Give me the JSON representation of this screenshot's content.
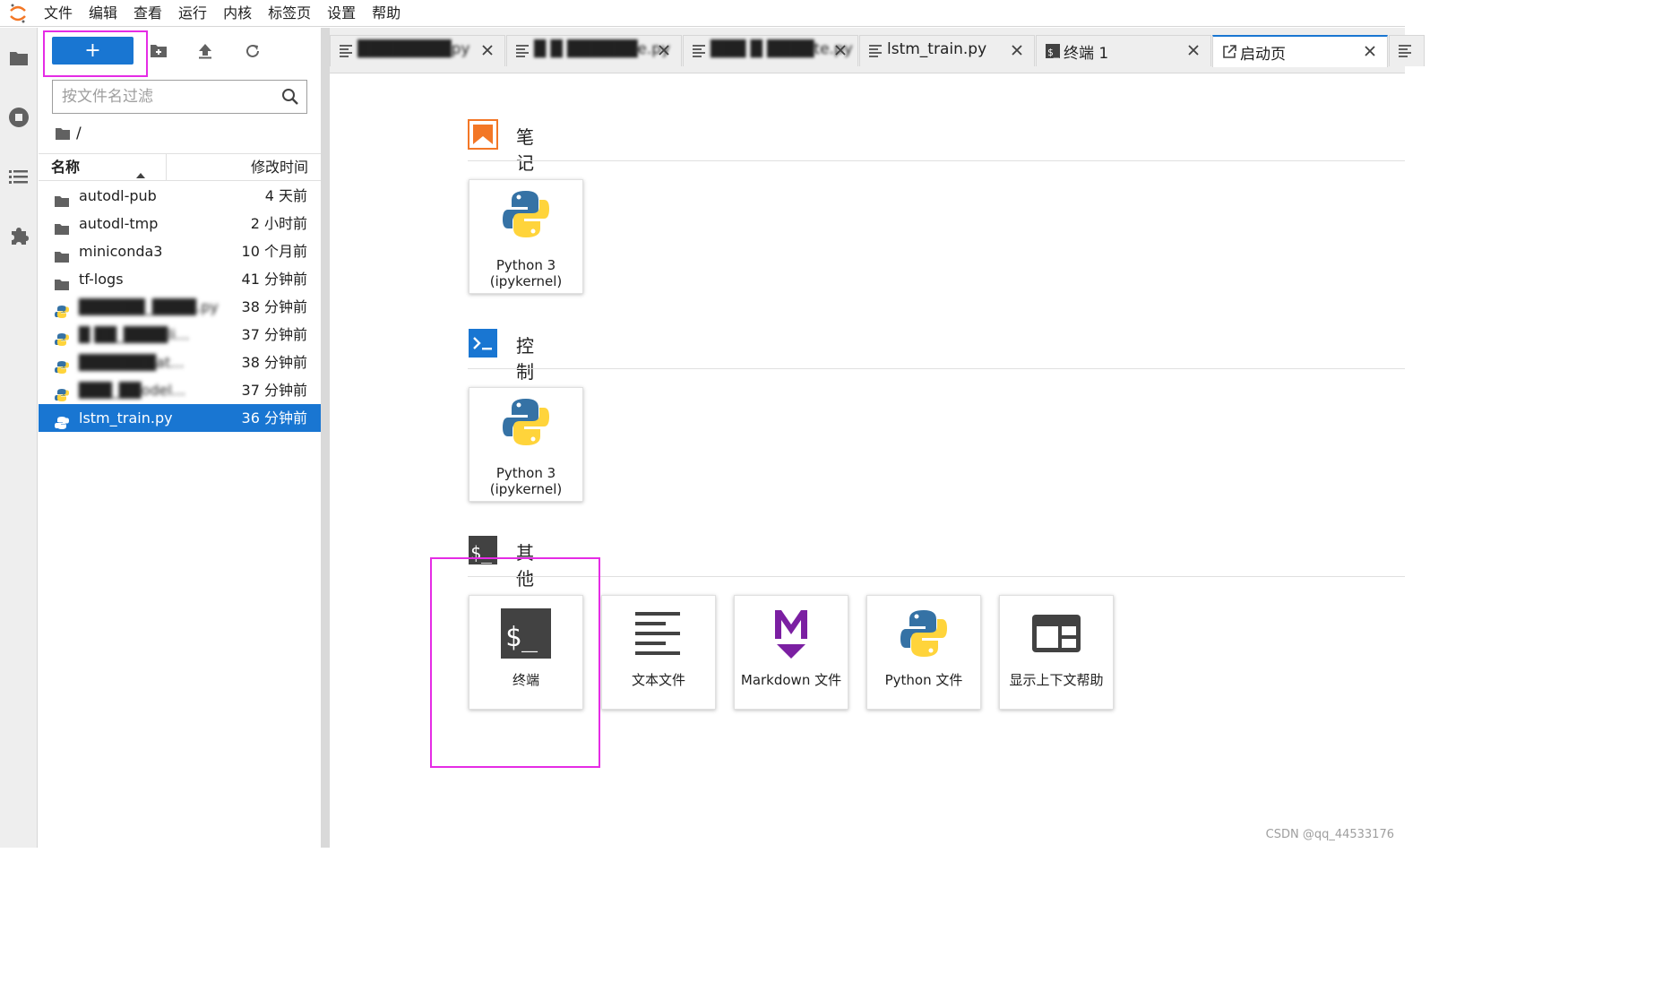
{
  "menubar": {
    "items": [
      "文件",
      "编辑",
      "查看",
      "运行",
      "内核",
      "标签页",
      "设置",
      "帮助"
    ]
  },
  "sidebar_icons": [
    "folder-icon",
    "stop-circle-icon",
    "list-icon",
    "puzzle-icon"
  ],
  "filebrowser": {
    "new_button_label": "+",
    "filter_placeholder": "按文件名过滤",
    "breadcrumb": "/",
    "header": {
      "name": "名称",
      "modified": "修改时间"
    },
    "files": [
      {
        "name": "autodl-pub",
        "time": "4 天前",
        "type": "folder"
      },
      {
        "name": "autodl-tmp",
        "time": "2 小时前",
        "type": "folder"
      },
      {
        "name": "miniconda3",
        "time": "10 个月前",
        "type": "folder"
      },
      {
        "name": "tf-logs",
        "time": "41 分钟前",
        "type": "folder"
      },
      {
        "name": "██████_████.py",
        "time": "38 分钟前",
        "type": "python"
      },
      {
        "name": "█ ██_████li...",
        "time": "37 分钟前",
        "type": "python"
      },
      {
        "name": "███████at...",
        "time": "38 分钟前",
        "type": "python"
      },
      {
        "name": "███_██odel...",
        "time": "37 分钟前",
        "type": "python"
      },
      {
        "name": "lstm_train.py",
        "time": "36 分钟前",
        "type": "python"
      }
    ]
  },
  "tabs": [
    {
      "label": "████████py",
      "icon": "text-file-icon"
    },
    {
      "label": "█ █ ██████e.py",
      "icon": "text-file-icon"
    },
    {
      "label": "███ █ ████te.py",
      "icon": "text-file-icon"
    },
    {
      "label": "lstm_train.py",
      "icon": "text-file-icon"
    },
    {
      "label": "终端 1",
      "icon": "terminal-icon"
    },
    {
      "label": "启动页",
      "icon": "launcher-icon"
    }
  ],
  "launcher": {
    "notebook": {
      "title": "笔记本",
      "cards": [
        {
          "label_line1": "Python 3",
          "label_line2": "(ipykernel)"
        }
      ]
    },
    "console": {
      "title": "控制台",
      "cards": [
        {
          "label_line1": "Python 3",
          "label_line2": "(ipykernel)"
        }
      ]
    },
    "other": {
      "title": "其他",
      "cards": [
        {
          "label": "终端"
        },
        {
          "label": "文本文件"
        },
        {
          "label": "Markdown 文件"
        },
        {
          "label": "Python 文件"
        },
        {
          "label": "显示上下文帮助"
        }
      ]
    }
  },
  "colors": {
    "accent": "#1976d2",
    "highlight": "#e52ce5",
    "markdown": "#7b1fa2",
    "notebook": "#f37726"
  },
  "watermark": "CSDN @qq_44533176"
}
